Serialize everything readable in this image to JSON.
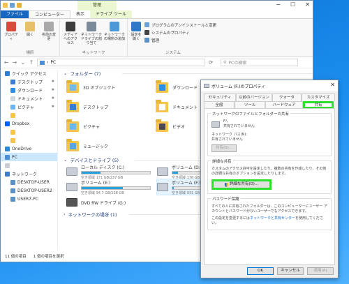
{
  "explorer": {
    "title_chip": "管理",
    "ribbon_tabs": [
      "ファイル",
      "コンピューター",
      "表示",
      "ドライブ ツール"
    ],
    "ribbon": {
      "groups": [
        {
          "label": "場所",
          "buttons": [
            "プロパティ",
            "開く",
            "名前の変更"
          ]
        },
        {
          "label": "ネットワーク",
          "buttons": [
            "メディアへのアクセス",
            "ネットワーク ドライブの割り当て",
            "ネットワークの場所の追加"
          ]
        },
        {
          "label": "システム",
          "buttons": [
            "設定を開く"
          ],
          "list": [
            "プログラムのアンインストールと変更",
            "システムのプロパティ",
            "管理"
          ]
        }
      ]
    },
    "address": {
      "path": "PC",
      "search_placeholder": "PCの検索"
    },
    "sidebar": {
      "items": [
        {
          "label": "クイック アクセス",
          "top": true
        },
        {
          "label": "デスクトップ",
          "pinned": true
        },
        {
          "label": "ダウンロード",
          "pinned": true
        },
        {
          "label": "ドキュメント",
          "pinned": true
        },
        {
          "label": "ピクチャ",
          "pinned": true
        },
        {
          "label": "",
          "pinned": false
        },
        {
          "label": "Dropbox",
          "top": true
        },
        {
          "label": "",
          "pinned": false
        },
        {
          "label": "",
          "pinned": false
        },
        {
          "label": "OneDrive",
          "top": true
        },
        {
          "label": "PC",
          "top": true,
          "selected": true
        },
        {
          "label": "",
          "top": true
        },
        {
          "label": "ネットワーク",
          "top": true
        },
        {
          "label": "DESKTOP-USER"
        },
        {
          "label": "DESKTOP-USER2"
        },
        {
          "label": "USER7-PC"
        }
      ]
    },
    "folders_header": "フォルダー (7)",
    "folders": [
      {
        "name": "3D オブジェクト",
        "badge": "#7ab6e8"
      },
      {
        "name": "ダウンロード",
        "badge": "#2e8de6"
      },
      {
        "name": "デスクトップ",
        "badge": "#3a7bd5"
      },
      {
        "name": "ドキュメント",
        "badge": "#ffffff"
      },
      {
        "name": "ピクチャ",
        "badge": "#6cb4f2"
      },
      {
        "name": "ビデオ",
        "badge": "#4a4a4a"
      },
      {
        "name": "ミュージック",
        "badge": "#5aa3e6"
      }
    ],
    "drives_header": "デバイスとドライブ (5)",
    "drives": [
      {
        "name": "ローカル ディスク (C:)",
        "free": "空き領域 171 GB/237 GB",
        "used": 0.28,
        "selected": false
      },
      {
        "name": "ボリューム (D:)",
        "free": "空き領域 176 GB",
        "used": 0.08,
        "selected": false
      },
      {
        "name": "ボリューム (E:)",
        "free": "空き領域 94.7 GB/238 GB",
        "used": 0.6,
        "selected": false
      },
      {
        "name": "ボリューム (F:)",
        "free": "空き領域 931 GB",
        "used": 0.02,
        "selected": true
      },
      {
        "name": "DVD RW ドライブ (G:)",
        "free": "",
        "used": null,
        "selected": false
      }
    ],
    "network_header": "ネットワークの場所 (1)",
    "status": {
      "items": "11 個の項目",
      "selected": "1 個の項目を選択"
    }
  },
  "dialog": {
    "title": "ボリューム (F:)のプロパティ",
    "tabs_row1": [
      "セキュリティ",
      "以前のバージョン",
      "クォータ",
      "カスタマイズ"
    ],
    "tabs_row2": [
      "全般",
      "ツール",
      "ハードウェア",
      "共有"
    ],
    "network_share": {
      "title": "ネットワークのファイルとフォルダーの共有",
      "drive": "F:\\",
      "status": "共有されていません",
      "path_label": "ネットワーク パス(N):",
      "path_value": "共有されていません",
      "share_button": "共有(S)..."
    },
    "advanced": {
      "title": "詳細な共有",
      "desc": "カスタムのアクセス許可を設定したり、複数の共有を作成したり、その他の詳細な共有のオプションを設定したりします。",
      "button": "詳細な共有(D)..."
    },
    "password": {
      "title": "パスワード保護",
      "desc": "すべての人に共有されたフォルダーは、このコンピューターにユーザー アカウントとパスワードがないユーザーでもアクセスできます。",
      "change_prefix": "この設定を変更するには",
      "link": "ネットワークと共有センター",
      "change_suffix": "を使用してください。"
    },
    "footer": {
      "ok": "OK",
      "cancel": "キャンセル",
      "apply": "適用(A)"
    }
  }
}
